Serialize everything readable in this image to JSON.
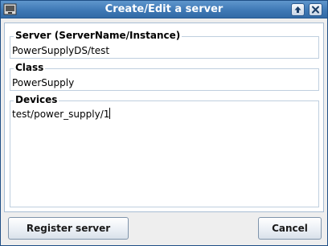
{
  "window": {
    "title": "Create/Edit a server"
  },
  "form": {
    "server": {
      "label": "Server  (ServerName/Instance)",
      "value": "PowerSupplyDS/test"
    },
    "class": {
      "label": "Class",
      "value": "PowerSupply"
    },
    "devices": {
      "label": "Devices",
      "value": "test/power_supply/1"
    }
  },
  "buttons": {
    "register_label": "Register server",
    "cancel_label": "Cancel"
  },
  "icons": {
    "app": "app-window-icon",
    "maximize": "maximize-arrow-up-icon",
    "close": "close-x-icon"
  },
  "colors": {
    "titlebar": "#3f79b6",
    "title_text": "#ffffff",
    "group_border": "#bfcfdf"
  }
}
